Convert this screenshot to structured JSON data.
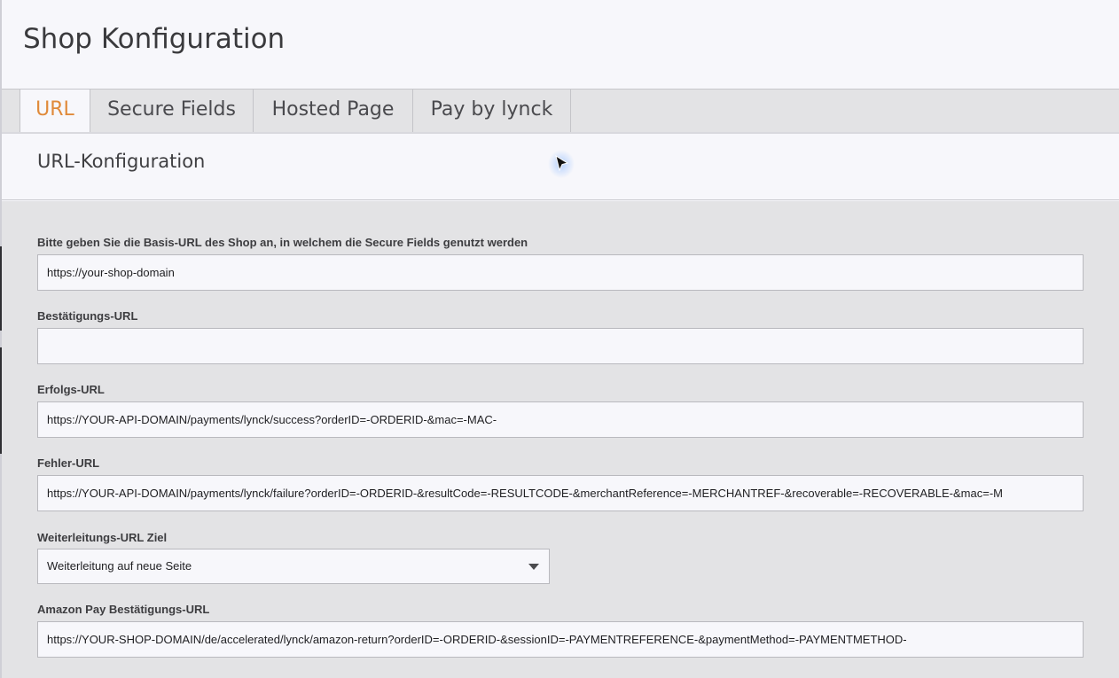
{
  "header": {
    "title": "Shop Konfiguration"
  },
  "tabs": [
    {
      "label": "URL",
      "active": true
    },
    {
      "label": "Secure Fields",
      "active": false
    },
    {
      "label": "Hosted Page",
      "active": false
    },
    {
      "label": "Pay by lynck",
      "active": false
    }
  ],
  "section": {
    "title": "URL-Konfiguration"
  },
  "form": {
    "base_url": {
      "label": "Bitte geben Sie die Basis-URL des Shop an, in welchem die Secure Fields genutzt werden",
      "value": "https://your-shop-domain"
    },
    "confirm_url": {
      "label": "Bestätigungs-URL",
      "value": ""
    },
    "success_url": {
      "label": "Erfolgs-URL",
      "value": "https://YOUR-API-DOMAIN/payments/lynck/success?orderID=-ORDERID-&mac=-MAC-"
    },
    "error_url": {
      "label": "Fehler-URL",
      "value": "https://YOUR-API-DOMAIN/payments/lynck/failure?orderID=-ORDERID-&resultCode=-RESULTCODE-&merchantReference=-MERCHANTREF-&recoverable=-RECOVERABLE-&mac=-M"
    },
    "redirect_target": {
      "label": "Weiterleitungs-URL Ziel",
      "selected": "Weiterleitung auf neue Seite"
    },
    "amazon_url": {
      "label": "Amazon Pay Bestätigungs-URL",
      "value": "https://YOUR-SHOP-DOMAIN/de/accelerated/lynck/amazon-return?orderID=-ORDERID-&sessionID=-PAYMENTREFERENCE-&paymentMethod=-PAYMENTMETHOD-"
    }
  },
  "colors": {
    "accent": "#e08a3a",
    "background": "#f7f7fb",
    "panel": "#e3e3e5"
  },
  "icons": {
    "cursor": "mouse-cursor-icon",
    "dropdown": "chevron-down-icon"
  }
}
